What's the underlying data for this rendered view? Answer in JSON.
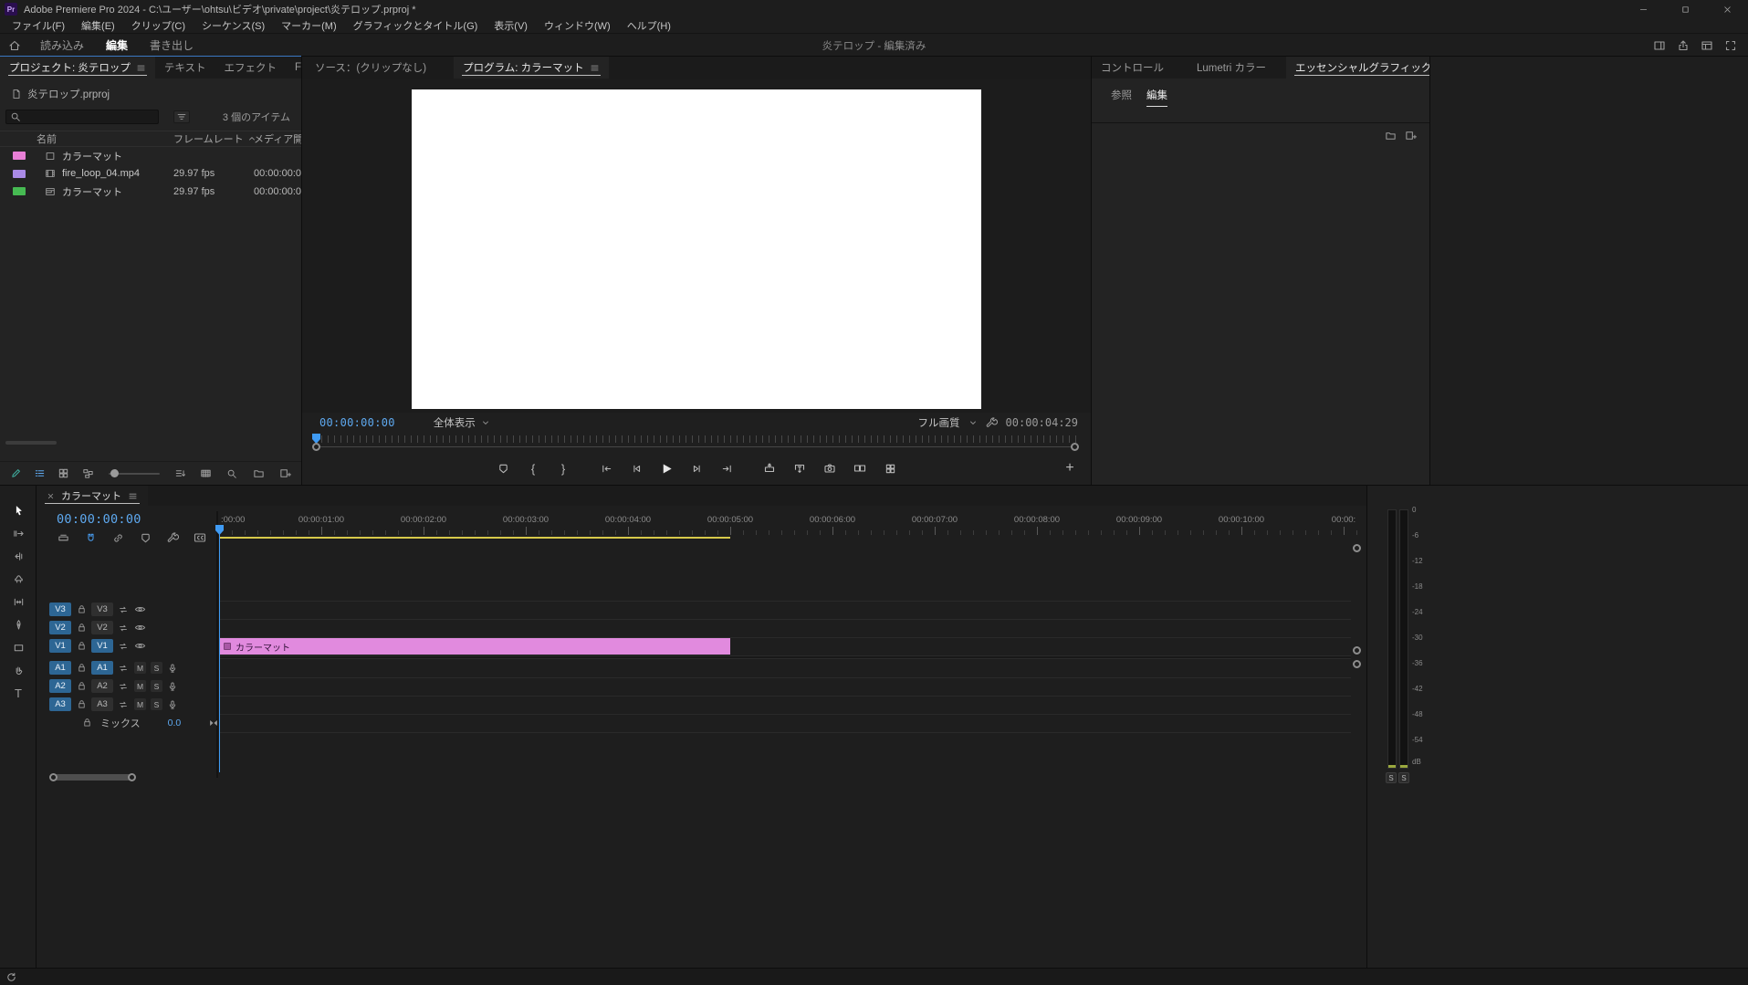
{
  "title_bar": {
    "logo": "Pr",
    "app_title": "Adobe Premiere Pro 2024 - C:\\ユーザー\\ohtsu\\ビデオ\\private\\project\\炎テロップ.prproj *"
  },
  "menu_bar": {
    "items": [
      "ファイル(F)",
      "編集(E)",
      "クリップ(C)",
      "シーケンス(S)",
      "マーカー(M)",
      "グラフィックとタイトル(G)",
      "表示(V)",
      "ウィンドウ(W)",
      "ヘルプ(H)"
    ]
  },
  "workspace_bar": {
    "tabs": [
      "読み込み",
      "編集",
      "書き出し"
    ],
    "active_tab": "編集",
    "document_status": "炎テロップ - 編集済み"
  },
  "project_panel": {
    "tab_project": "プロジェクト: 炎テロップ",
    "tab_text": "テキスト",
    "tab_effects": "エフェクト",
    "tab_more": "Fr",
    "overflow": "»",
    "breadcrumb": "炎テロップ.prproj",
    "item_count": "3 個のアイテム",
    "columns": {
      "name": "名前",
      "framerate": "フレームレート",
      "media_start": "メディア開"
    },
    "rows": [
      {
        "name": "カラーマット",
        "framerate": "",
        "media_start": "",
        "label_color": "#e87fd6"
      },
      {
        "name": "fire_loop_04.mp4",
        "framerate": "29.97 fps",
        "media_start": "00:00:00:0",
        "label_color": "#a98ae6"
      },
      {
        "name": "カラーマット",
        "framerate": "29.97 fps",
        "media_start": "00:00:00:0",
        "label_color": "#46ba52"
      }
    ]
  },
  "monitor": {
    "tab_source": "ソース：(クリップなし)",
    "tab_program": "プログラム: カラーマット",
    "timecode": "00:00:00:00",
    "zoom_level": "全体表示",
    "quality": "フル画質",
    "duration": "00:00:04:29",
    "add_button": "+"
  },
  "right_panel": {
    "tab_controls": "コントロール",
    "tab_lumetri": "Lumetri カラー",
    "tab_essential": "エッセンシャルグラフィックス",
    "tab_truncated": "エッ",
    "overflow": "»",
    "subtab_browse": "参照",
    "subtab_edit": "編集"
  },
  "tools": {
    "type_label": "T"
  },
  "timeline": {
    "tab": "カラーマット",
    "timecode": "00:00:00:00",
    "ruler": [
      ":00:00",
      "00:00:01:00",
      "00:00:02:00",
      "00:00:03:00",
      "00:00:04:00",
      "00:00:05:00",
      "00:00:06:00",
      "00:00:07:00",
      "00:00:08:00",
      "00:00:09:00",
      "00:00:10:00",
      "00:00:"
    ],
    "video_tracks": [
      {
        "patch": "V3",
        "target": "V3"
      },
      {
        "patch": "V2",
        "target": "V2"
      },
      {
        "patch": "V1",
        "target": "V1"
      }
    ],
    "audio_tracks": [
      {
        "patch": "A1",
        "target": "A1",
        "mute": "M",
        "solo": "S"
      },
      {
        "patch": "A2",
        "target": "A2",
        "mute": "M",
        "solo": "S"
      },
      {
        "patch": "A3",
        "target": "A3",
        "mute": "M",
        "solo": "S"
      }
    ],
    "master": {
      "label": "ミックス",
      "value": "0.0"
    },
    "clip": {
      "name": "カラーマット",
      "color": "#e18ade"
    }
  },
  "audio_meter": {
    "scale": [
      "0",
      "-6",
      "-12",
      "-18",
      "-24",
      "-30",
      "-36",
      "-42",
      "-48",
      "-54",
      "dB"
    ],
    "solo_left": "S",
    "solo_right": "S"
  },
  "colors": {
    "accent_blue": "#2f8ceb",
    "timecode_blue": "#5ea9f0",
    "track_button_blue": "#2d6694",
    "clip_pink": "#e18ade",
    "render_bar_yellow": "#d7c94a",
    "program_frame": "#ffffff",
    "label_pink": "#e87fd6",
    "label_violet": "#a98ae6",
    "label_green": "#46ba52"
  }
}
